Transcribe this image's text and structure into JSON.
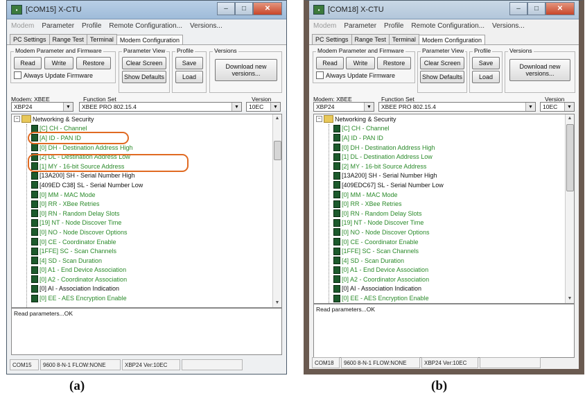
{
  "captions": {
    "a": "(a)",
    "b": "(b)"
  },
  "windows": [
    {
      "title": "[COM15] X-CTU",
      "menu": [
        "Modem",
        "Parameter",
        "Profile",
        "Remote Configuration...",
        "Versions..."
      ],
      "tabs": [
        "PC Settings",
        "Range Test",
        "Terminal",
        "Modem Configuration"
      ],
      "groups": {
        "modem_params": "Modem Parameter and Firmware",
        "param_view": "Parameter View",
        "profile": "Profile",
        "versions": "Versions"
      },
      "buttons": {
        "read": "Read",
        "write": "Write",
        "restore": "Restore",
        "clear_screen": "Clear Screen",
        "show_defaults": "Show Defaults",
        "save": "Save",
        "load": "Load",
        "download": "Download new versions..."
      },
      "always_update": "Always Update Firmware",
      "modem_label": "Modem: XBEE",
      "function_set_label": "Function Set",
      "version_label": "Version",
      "modem_value": "XBP24",
      "function_set_value": "XBEE PRO 802.15.4",
      "version_value": "10EC",
      "tree_root": "Networking & Security",
      "tree_items": [
        {
          "text": "[C] CH - Channel",
          "color": "green"
        },
        {
          "text": "[A] ID - PAN ID",
          "color": "green"
        },
        {
          "text": "[0] DH - Destination Address High",
          "color": "green"
        },
        {
          "text": "[2] DL - Destination Address Low",
          "color": "green"
        },
        {
          "text": "[1] MY - 16-bit Source Address",
          "color": "green"
        },
        {
          "text": "[13A200] SH - Serial Number High",
          "color": "black"
        },
        {
          "text": "[409ED C38] SL - Serial Number Low",
          "color": "black"
        },
        {
          "text": "[0] MM - MAC Mode",
          "color": "green"
        },
        {
          "text": "[0] RR - XBee Retries",
          "color": "green"
        },
        {
          "text": "[0] RN - Random Delay Slots",
          "color": "green"
        },
        {
          "text": "[19] NT - Node Discover Time",
          "color": "green"
        },
        {
          "text": "[0] NO - Node Discover Options",
          "color": "green"
        },
        {
          "text": "[0] CE - Coordinator Enable",
          "color": "green"
        },
        {
          "text": "[1FFE] SC - Scan Channels",
          "color": "green"
        },
        {
          "text": "[4] SD - Scan Duration",
          "color": "green"
        },
        {
          "text": "[0] A1 - End Device Association",
          "color": "green"
        },
        {
          "text": "[0] A2 - Coordinator Association",
          "color": "green"
        },
        {
          "text": "[0] AI - Association Indication",
          "color": "black"
        },
        {
          "text": "[0] EE - AES Encryption Enable",
          "color": "green"
        }
      ],
      "output_text": "Read parameters...OK",
      "status": [
        "COM15",
        "9600 8-N-1  FLOW:NONE",
        "XBP24  Ver:10EC",
        ""
      ],
      "highlight_color": "#e06a22"
    },
    {
      "title": "[COM18] X-CTU",
      "menu": [
        "Modem",
        "Parameter",
        "Profile",
        "Remote Configuration...",
        "Versions..."
      ],
      "tabs": [
        "PC Settings",
        "Range Test",
        "Terminal",
        "Modem Configuration"
      ],
      "groups": {
        "modem_params": "Modem Parameter and Firmware",
        "param_view": "Parameter View",
        "profile": "Profile",
        "versions": "Versions"
      },
      "buttons": {
        "read": "Read",
        "write": "Write",
        "restore": "Restore",
        "clear_screen": "Clear Screen",
        "show_defaults": "Show Defaults",
        "save": "Save",
        "load": "Load",
        "download": "Download new versions..."
      },
      "always_update": "Always Update Firmware",
      "modem_label": "Modem: XBEE",
      "function_set_label": "Function Set",
      "version_label": "Version",
      "modem_value": "XBP24",
      "function_set_value": "XBEE PRO 802.15.4",
      "version_value": "10EC",
      "tree_root": "Networking & Security",
      "tree_items": [
        {
          "text": "[C] CH - Channel",
          "color": "green"
        },
        {
          "text": "[A] ID - PAN ID",
          "color": "green"
        },
        {
          "text": "[0] DH - Destination Address High",
          "color": "green"
        },
        {
          "text": "[1] DL - Destination Address Low",
          "color": "green"
        },
        {
          "text": "[2] MY - 16-bit Source Address",
          "color": "green"
        },
        {
          "text": "[13A200] SH - Serial Number High",
          "color": "black"
        },
        {
          "text": "[409EDC67] SL - Serial Number Low",
          "color": "black"
        },
        {
          "text": "[0] MM - MAC Mode",
          "color": "green"
        },
        {
          "text": "[0] RR - XBee Retries",
          "color": "green"
        },
        {
          "text": "[0] RN - Random Delay Slots",
          "color": "green"
        },
        {
          "text": "[19] NT - Node Discover Time",
          "color": "green"
        },
        {
          "text": "[0] NO - Node Discover Options",
          "color": "green"
        },
        {
          "text": "[0] CE - Coordinator Enable",
          "color": "green"
        },
        {
          "text": "[1FFE] SC - Scan Channels",
          "color": "green"
        },
        {
          "text": "[4] SD - Scan Duration",
          "color": "green"
        },
        {
          "text": "[0] A1 - End Device Association",
          "color": "green"
        },
        {
          "text": "[0] A2 - Coordinator Association",
          "color": "green"
        },
        {
          "text": "[0] AI - Association Indication",
          "color": "black"
        },
        {
          "text": "[0] EE - AES Encryption Enable",
          "color": "green"
        }
      ],
      "output_text": "Read parameters...OK",
      "status": [
        "COM18",
        "9600 8-N-1  FLOW:NONE",
        "XBP24  Ver:10EC",
        ""
      ],
      "highlight_color": ""
    }
  ]
}
